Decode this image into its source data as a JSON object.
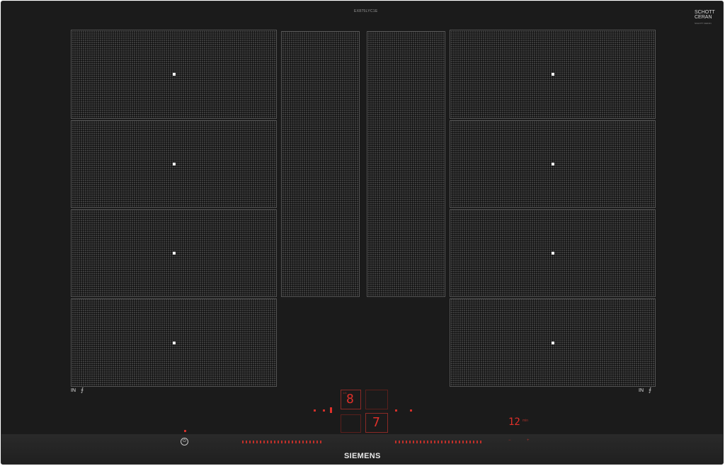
{
  "header": {
    "model_code": "EX875LYC1E",
    "logo_line1": "SCHOTT",
    "logo_line2": "CERAN",
    "logo_small": "SCHOTT CERAN"
  },
  "zones": {
    "left_labels": [
      "IN"
    ],
    "right_labels": [
      "IN"
    ]
  },
  "control_panel": {
    "left_display": "8",
    "left_display_small": "1/4",
    "center_display": "7",
    "right_display": "12",
    "right_display_unit": "min",
    "brand": "SIEMENS",
    "power_symbol": "⏻"
  },
  "colors": {
    "accent_red": "#e0302a",
    "glass": "#1b1b1b",
    "zone_surface": "#3c3c3c"
  }
}
